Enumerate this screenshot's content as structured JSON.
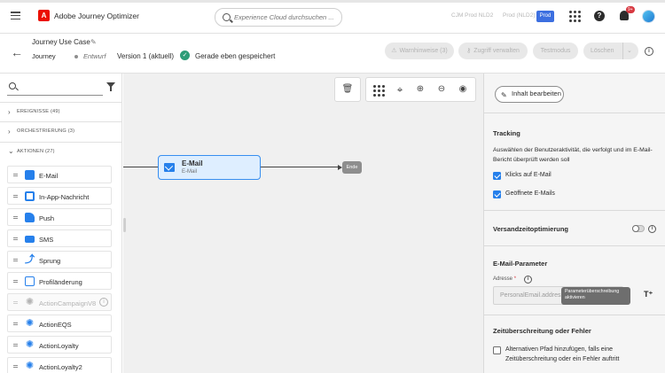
{
  "topbar": {
    "app_title": "Adobe Journey Optimizer",
    "logo_letter": "A",
    "search_placeholder": "Experience Cloud durchsuchen ...",
    "org_label": "CJM Prod NLD2",
    "sandbox_label": "Prod (NLD2)",
    "env_badge": "Prod",
    "notification_count": "9+",
    "help_symbol": "?"
  },
  "journey_header": {
    "name": "Journey Use Case",
    "type": "Journey",
    "status": "Entwurf",
    "version": "Version 1 (aktuell)",
    "saved_status": "Gerade eben gespeichert",
    "buttons": {
      "warnings": "Warnhinweise (3)",
      "manage_access": "Zugriff verwalten",
      "test_mode": "Testmodus",
      "delete": "Löschen"
    }
  },
  "left_panel": {
    "sections": {
      "events": "EREIGNISSE (49)",
      "orchestration": "ORCHESTRIERUNG (3)",
      "actions": "AKTIONEN (27)"
    },
    "actions": [
      {
        "label": "E-Mail",
        "icon": "email-icon",
        "color": "#2680eb"
      },
      {
        "label": "In-App-Nachricht",
        "icon": "inapp-icon",
        "color": "#2680eb"
      },
      {
        "label": "Push",
        "icon": "push-icon",
        "color": "#2680eb"
      },
      {
        "label": "SMS",
        "icon": "sms-icon",
        "color": "#2680eb"
      },
      {
        "label": "Sprung",
        "icon": "jump-icon",
        "color": "#2680eb"
      },
      {
        "label": "Profiländerung",
        "icon": "profile-update-icon",
        "color": "#2680eb"
      },
      {
        "label": "ActionCampaignV8",
        "icon": "custom-action-icon",
        "color": "#b3b3b3"
      },
      {
        "label": "ActionEQS",
        "icon": "custom-action-icon",
        "color": "#2680eb"
      },
      {
        "label": "ActionLoyalty",
        "icon": "custom-action-icon",
        "color": "#2680eb"
      },
      {
        "label": "ActionLoyalty2",
        "icon": "custom-action-icon",
        "color": "#2680eb"
      }
    ]
  },
  "canvas": {
    "email_node": {
      "title": "E-Mail",
      "subtitle": "E-Mail"
    },
    "end_node": "Ende"
  },
  "right_panel": {
    "edit_content_button": "Inhalt bearbeiten",
    "tracking": {
      "title": "Tracking",
      "description": "Auswählen der Benutzeraktivität, die verfolgt und im E-Mail-Bericht überprüft werden soll",
      "options": [
        {
          "label": "Klicks auf E-Mail",
          "checked": true
        },
        {
          "label": "Geöffnete E-Mails",
          "checked": true
        }
      ]
    },
    "send_time_optimization": {
      "title": "Versandzeitoptimierung",
      "enabled": false
    },
    "email_parameters": {
      "title": "E-Mail-Parameter",
      "address_label": "Adresse",
      "address_value": "PersonalEmail.address",
      "tooltip": "Parameterüberschreibung aktivieren"
    },
    "timeout_error": {
      "title": "Zeitüberschreitung oder Fehler",
      "option": "Alternativen Pfad hinzufügen, falls eine Zeitüberschreitung oder ein Fehler auftritt",
      "checked": false
    }
  }
}
